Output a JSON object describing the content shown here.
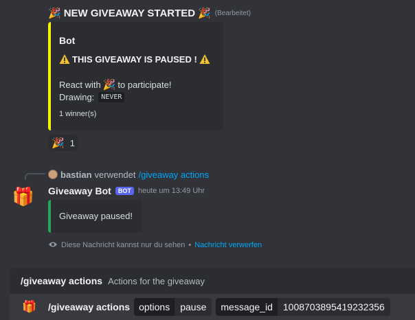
{
  "message_top": {
    "title": "NEW GIVEAWAY STARTED",
    "edited_label": "(Bearbeitet)",
    "emoji_icon": "party-popper-icon"
  },
  "giveaway_embed": {
    "accent_color": "#f6f600",
    "author": "Bot",
    "paused_text": "THIS GIVEAWAY IS PAUSED !",
    "react_prefix": "React with",
    "react_suffix": "to participate!",
    "drawing_label": "Drawing:",
    "drawing_value": "NEVER",
    "footer": "1 winner(s)"
  },
  "reaction": {
    "emoji_icon": "party-popper-icon",
    "count": "1"
  },
  "reply": {
    "username": "bastian",
    "uses_text": "verwendet",
    "command": "/giveaway actions"
  },
  "bot_message": {
    "bot_name": "Giveaway Bot",
    "bot_tag": "BOT",
    "timestamp": "heute um 13:49 Uhr",
    "avatar_icon": "gift-icon",
    "embed_accent_color": "#23a55a",
    "embed_text": "Giveaway paused!",
    "ephemeral_text": "Diese Nachricht kannst nur du sehen",
    "ephemeral_separator": "•",
    "dismiss_link": "Nachricht verwerfen"
  },
  "command_panel": {
    "command_name": "/giveaway actions",
    "command_description": "Actions for the giveaway",
    "input_icon": "gift-icon",
    "input_command": "/giveaway actions",
    "options": [
      {
        "name": "options",
        "value": "pause"
      },
      {
        "name": "message_id",
        "value": "1008703895419232356"
      }
    ]
  }
}
